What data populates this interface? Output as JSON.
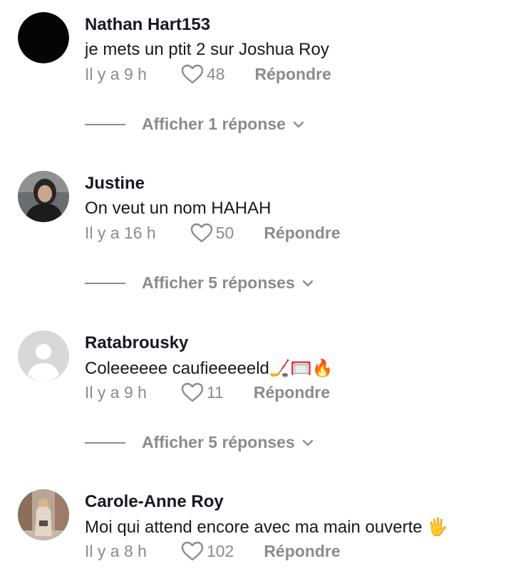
{
  "comments": [
    {
      "username": "Nathan Hart153",
      "text": "je mets un ptit 2 sur Joshua Roy",
      "time": "Il y a 9 h",
      "likes": "48",
      "reply_label": "Répondre",
      "replies_label": "Afficher 1 réponse",
      "avatar": "black"
    },
    {
      "username": "Justine",
      "text": "On veut un nom HAHAH",
      "time": "Il y a 16 h",
      "likes": "50",
      "reply_label": "Répondre",
      "replies_label": "Afficher 5 réponses",
      "avatar": "photo"
    },
    {
      "username": "Ratabrousky",
      "text": "Coleeeeee caufieeeeeld🏒🥅🔥",
      "time": "Il y a 9 h",
      "likes": "11",
      "reply_label": "Répondre",
      "replies_label": "Afficher 5 réponses",
      "avatar": "default"
    },
    {
      "username": "Carole-Anne Roy",
      "text": "Moi qui attend encore avec ma main ouverte 🖐️",
      "time": "Il y a 8 h",
      "likes": "102",
      "reply_label": "Répondre",
      "avatar": "photo"
    }
  ],
  "colors": {
    "text": "#161823",
    "secondary": "#8a8b91",
    "background": "#ffffff"
  }
}
